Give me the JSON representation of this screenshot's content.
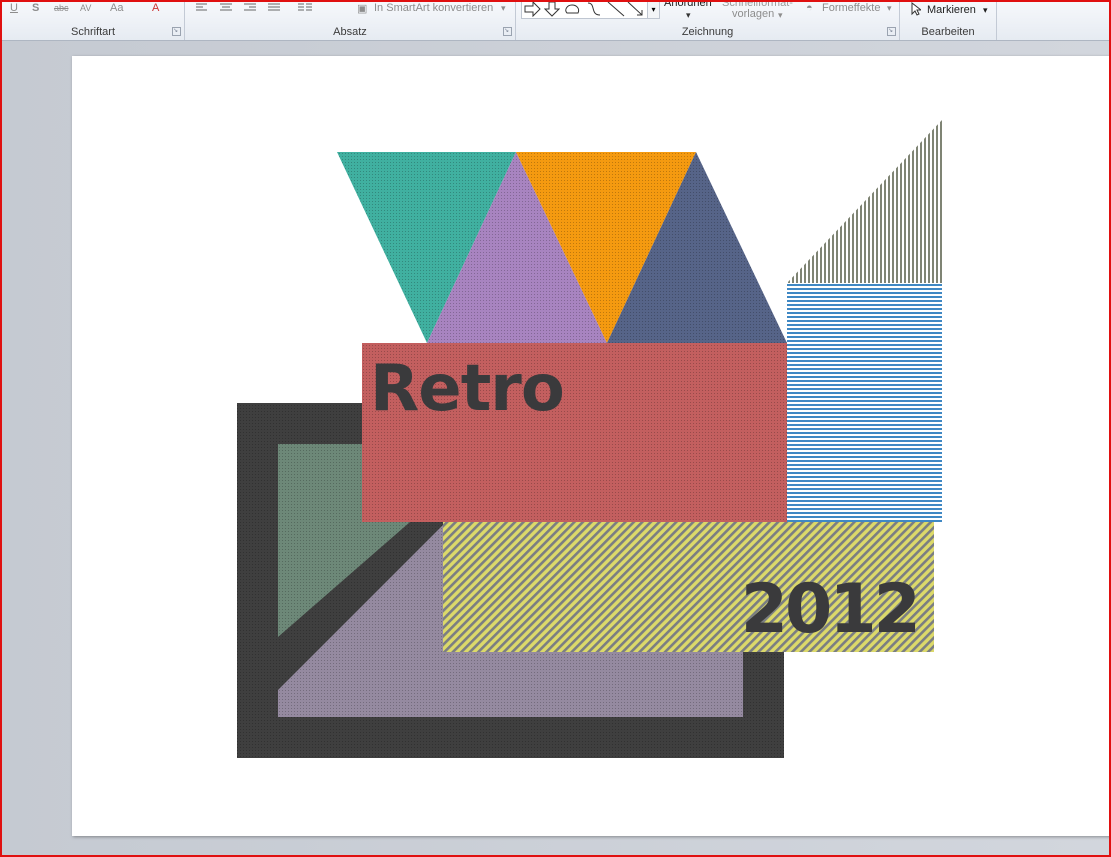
{
  "ribbon": {
    "groups": {
      "schriftart": "Schriftart",
      "absatz": "Absatz",
      "zeichnung": "Zeichnung",
      "bearbeiten": "Bearbeiten"
    },
    "font_buttons": {
      "underline": "U",
      "shadow": "S",
      "strikethrough": "abc",
      "spacing": "AV",
      "case": "Aa",
      "font_color": "A"
    },
    "smartart": "In SmartArt konvertieren",
    "anordnen": "Anordnen",
    "schnellformat": "Schnellformat-",
    "vorlagen": "vorlagen",
    "formeffekte": "Formeffekte",
    "markieren": "Markieren",
    "dropdown": "▾"
  },
  "slide": {
    "title": "Retro",
    "year": "2012"
  },
  "colors": {
    "teal": "#40b0a0",
    "purple": "#a884c0",
    "orange": "#f59a10",
    "navy": "#566488",
    "olive": "#8d9080",
    "blue_stripe": "#3f88c4",
    "red": "#c35f5f",
    "yellow": "#d2d063",
    "dark": "#3f3f3f",
    "sage": "#6d8878",
    "lavender": "#958aa0",
    "text": "#3a3a3c"
  }
}
